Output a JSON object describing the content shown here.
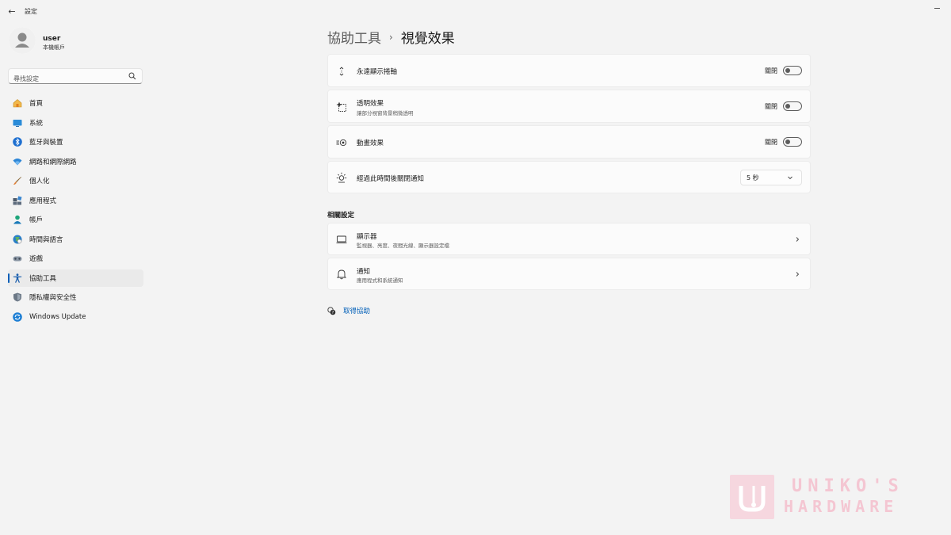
{
  "window": {
    "title": "設定"
  },
  "user": {
    "name": "user",
    "account_type": "本機帳戶"
  },
  "search": {
    "placeholder": "尋找設定"
  },
  "sidebar": {
    "items": [
      {
        "label": "首頁",
        "icon": "home-icon"
      },
      {
        "label": "系統",
        "icon": "system-icon"
      },
      {
        "label": "藍牙與裝置",
        "icon": "bluetooth-icon"
      },
      {
        "label": "網路和網際網路",
        "icon": "wifi-icon"
      },
      {
        "label": "個人化",
        "icon": "brush-icon"
      },
      {
        "label": "應用程式",
        "icon": "apps-icon"
      },
      {
        "label": "帳戶",
        "icon": "account-icon"
      },
      {
        "label": "時間與語言",
        "icon": "globe-icon"
      },
      {
        "label": "遊戲",
        "icon": "gamepad-icon"
      },
      {
        "label": "協助工具",
        "icon": "accessibility-icon",
        "active": true
      },
      {
        "label": "隱私權與安全性",
        "icon": "shield-icon"
      },
      {
        "label": "Windows Update",
        "icon": "update-icon"
      }
    ]
  },
  "breadcrumb": {
    "parent": "協助工具",
    "separator": "›",
    "current": "視覺效果"
  },
  "settings": {
    "scrollbars": {
      "title": "永遠顯示捲軸",
      "state": "關閉"
    },
    "transparency": {
      "title": "透明效果",
      "subtitle": "讓部分視窗背景稍微透明",
      "state": "關閉"
    },
    "animation": {
      "title": "動畫效果",
      "state": "關閉"
    },
    "notification_timeout": {
      "title": "經過此時間後關閉通知",
      "value": "5 秒"
    }
  },
  "related": {
    "title": "相關設定",
    "display": {
      "title": "顯示器",
      "subtitle": "監視器、亮度、夜間光線、顯示器設定檔"
    },
    "notifications": {
      "title": "通知",
      "subtitle": "應用程式和系統通知"
    }
  },
  "help": {
    "label": "取得協助"
  },
  "watermark": {
    "line1": "UNIKO'S",
    "line2": "HARDWARE"
  },
  "colors": {
    "accent": "#005fb8",
    "background": "#f3f3f3",
    "card": "#fbfbfb"
  }
}
